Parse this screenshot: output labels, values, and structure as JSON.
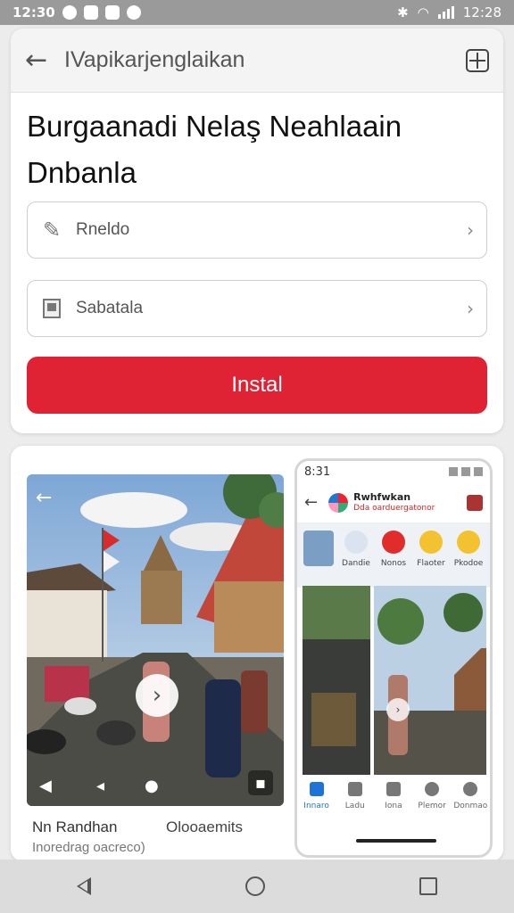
{
  "status_bar": {
    "time": "12:30",
    "clock_right": "12:28"
  },
  "app_bar": {
    "title": "IVapikarjenglaikan"
  },
  "headline": {
    "line1": "Burgaanadi Nelaş Neahlaain",
    "line2": "Dnbanla"
  },
  "fields": [
    {
      "label": "Rneldo",
      "icon": "pencil-icon"
    },
    {
      "label": "Sabatala",
      "icon": "flag-icon"
    }
  ],
  "install_button": {
    "label": "Instal",
    "color": "#e02334"
  },
  "gallery": {
    "caption_title": "Nn Randhan",
    "caption_subtitle": "Inoredrag oacreco)",
    "caption_right": "Olooaemits",
    "phone": {
      "time": "8:31",
      "title": "Rwhfwkan",
      "subtitle": "Dda oarduergatonor",
      "chips": [
        "Dandie",
        "Nonos",
        "Flaoter",
        "Pkodoe"
      ],
      "nav": [
        "Innaro",
        "Ladu",
        "Iona",
        "Plemor",
        "Donmao"
      ]
    }
  }
}
